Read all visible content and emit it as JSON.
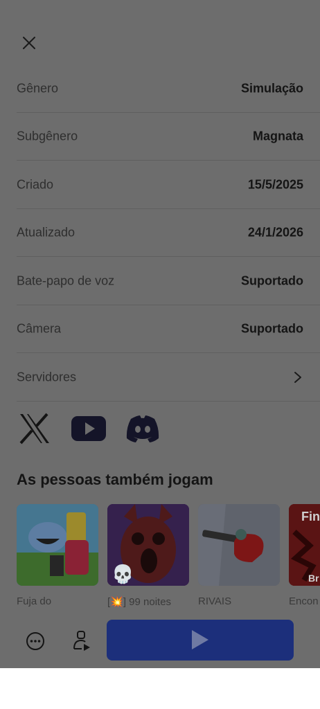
{
  "details": [
    {
      "label": "Gênero",
      "value": "Simulação"
    },
    {
      "label": "Subgênero",
      "value": "Magnata"
    },
    {
      "label": "Criado",
      "value": "15/5/2025"
    },
    {
      "label": "Atualizado",
      "value": "24/1/2026"
    },
    {
      "label": "Bate-papo de voz",
      "value": "Suportado"
    },
    {
      "label": "Câmera",
      "value": "Suportado"
    }
  ],
  "servers_label": "Servidores",
  "social": [
    "x-icon",
    "youtube-icon",
    "discord-icon"
  ],
  "section_title": "As pessoas também jogam",
  "games": [
    {
      "name": "Fuja do"
    },
    {
      "name": "[💥] 99 noites"
    },
    {
      "name": "RIVAIS"
    },
    {
      "name": "Encon"
    }
  ],
  "colors": {
    "play_button": "#1c2f7b",
    "overlay": "#6d6d6d"
  }
}
